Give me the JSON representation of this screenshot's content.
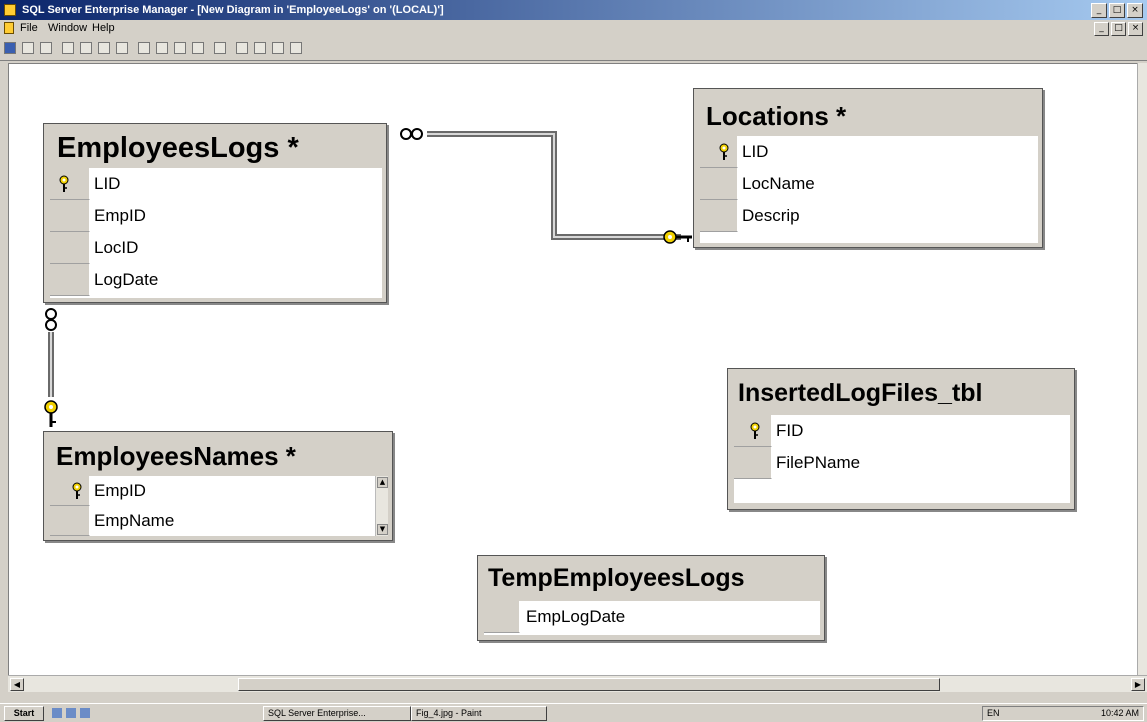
{
  "window": {
    "title": "SQL Server Enterprise Manager - [New Diagram in 'EmployeeLogs' on '(LOCAL)']",
    "controls": [
      "_",
      "□",
      "×"
    ]
  },
  "menubar": {
    "items": [
      "File",
      "Window",
      "Help"
    ]
  },
  "tables": {
    "employees_logs": {
      "title": "EmployeesLogs *",
      "columns": [
        {
          "name": "LID",
          "key": true
        },
        {
          "name": "EmpID",
          "key": false
        },
        {
          "name": "LocID",
          "key": false
        },
        {
          "name": "LogDate",
          "key": false
        }
      ]
    },
    "locations": {
      "title": "Locations *",
      "columns": [
        {
          "name": "LID",
          "key": true
        },
        {
          "name": "LocName",
          "key": false
        },
        {
          "name": "Descrip",
          "key": false
        }
      ]
    },
    "employees_names": {
      "title": "EmployeesNames *",
      "columns": [
        {
          "name": "EmpID",
          "key": true
        },
        {
          "name": "EmpName",
          "key": false
        }
      ]
    },
    "inserted_log_files": {
      "title": "InsertedLogFiles_tbl",
      "columns": [
        {
          "name": "FID",
          "key": true
        },
        {
          "name": "FilePName",
          "key": false
        }
      ]
    },
    "temp_employees_logs": {
      "title": "TempEmployeesLogs",
      "columns": [
        {
          "name": "EmpLogDate",
          "key": false
        }
      ]
    }
  },
  "relationships": [
    {
      "from": "EmployeesLogs",
      "to": "Locations",
      "many_end": "EmployeesLogs",
      "one_end": "Locations"
    },
    {
      "from": "EmployeesLogs",
      "to": "EmployeesNames",
      "many_end": "EmployeesLogs",
      "one_end": "EmployeesNames"
    }
  ],
  "taskbar": {
    "start_label": "Start",
    "tasks": [
      "SQL Server Enterprise...",
      "Fig_4.jpg - Paint"
    ],
    "tray_lang": "EN",
    "clock": "10:42 AM"
  },
  "colors": {
    "title_bar": "#0a246a",
    "table_header": "#d4d0c8",
    "key_icon": "#f0d000",
    "relationship_line": "#808080"
  }
}
